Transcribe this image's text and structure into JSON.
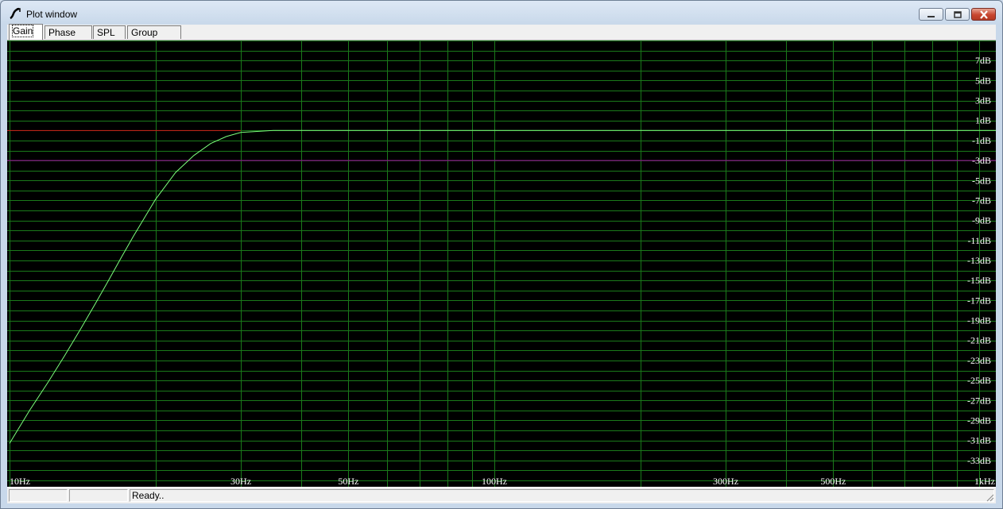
{
  "window": {
    "title": "Plot window"
  },
  "tabs": [
    {
      "label": "Gain",
      "active": true
    },
    {
      "label": "Phase plot",
      "active": false
    },
    {
      "label": "SPL",
      "active": false
    },
    {
      "label": "Group delay",
      "active": false
    }
  ],
  "status": {
    "panel1": "",
    "panel2": "",
    "message": "Ready.."
  },
  "colors": {
    "background": "#000000",
    "grid": "#1a7a1a",
    "gain_curve": "#7cff7c",
    "reference_line": "#d01818",
    "minus3db_line": "#a000a0",
    "tick_label": "#ffffff"
  },
  "chart_data": {
    "type": "line",
    "x_scale": "log",
    "xlim": [
      10,
      1000
    ],
    "ylim": [
      -35,
      9
    ],
    "grid": true,
    "x_tick_labels": [
      {
        "value": 10,
        "label": "10Hz"
      },
      {
        "value": 30,
        "label": "30Hz"
      },
      {
        "value": 50,
        "label": "50Hz"
      },
      {
        "value": 100,
        "label": "100Hz"
      },
      {
        "value": 300,
        "label": "300Hz"
      },
      {
        "value": 500,
        "label": "500Hz"
      },
      {
        "value": 1000,
        "label": "1kHz"
      }
    ],
    "x_grid_values": [
      10,
      20,
      30,
      40,
      50,
      60,
      70,
      80,
      90,
      100,
      200,
      300,
      400,
      500,
      600,
      700,
      800,
      900,
      1000
    ],
    "y_tick_labels": [
      {
        "value": 7,
        "label": "7dB"
      },
      {
        "value": 5,
        "label": "5dB"
      },
      {
        "value": 3,
        "label": "3dB"
      },
      {
        "value": 1,
        "label": "1dB"
      },
      {
        "value": -1,
        "label": "-1dB"
      },
      {
        "value": -3,
        "label": "-3dB"
      },
      {
        "value": -5,
        "label": "-5dB"
      },
      {
        "value": -7,
        "label": "-7dB"
      },
      {
        "value": -9,
        "label": "-9dB"
      },
      {
        "value": -11,
        "label": "-11dB"
      },
      {
        "value": -13,
        "label": "-13dB"
      },
      {
        "value": -15,
        "label": "-15dB"
      },
      {
        "value": -17,
        "label": "-17dB"
      },
      {
        "value": -19,
        "label": "-19dB"
      },
      {
        "value": -21,
        "label": "-21dB"
      },
      {
        "value": -23,
        "label": "-23dB"
      },
      {
        "value": -25,
        "label": "-25dB"
      },
      {
        "value": -27,
        "label": "-27dB"
      },
      {
        "value": -29,
        "label": "-29dB"
      },
      {
        "value": -31,
        "label": "-31dB"
      },
      {
        "value": -33,
        "label": "-33dB"
      }
    ],
    "reference_lines": [
      {
        "y": 0,
        "x_end": 30
      },
      {
        "y": -3
      }
    ],
    "series": [
      {
        "x": [
          10,
          11,
          12,
          13,
          14,
          15,
          16,
          17,
          18,
          19,
          20,
          22,
          24,
          26,
          28,
          30,
          35,
          40,
          45,
          50,
          100,
          1000
        ],
        "y": [
          -31.3,
          -28.0,
          -25.2,
          -22.5,
          -19.9,
          -17.4,
          -15.0,
          -12.7,
          -10.6,
          -8.7,
          -6.9,
          -4.2,
          -2.5,
          -1.3,
          -0.6,
          -0.2,
          0.0,
          0.0,
          0.0,
          0.0,
          0.0,
          0.0
        ]
      }
    ]
  }
}
